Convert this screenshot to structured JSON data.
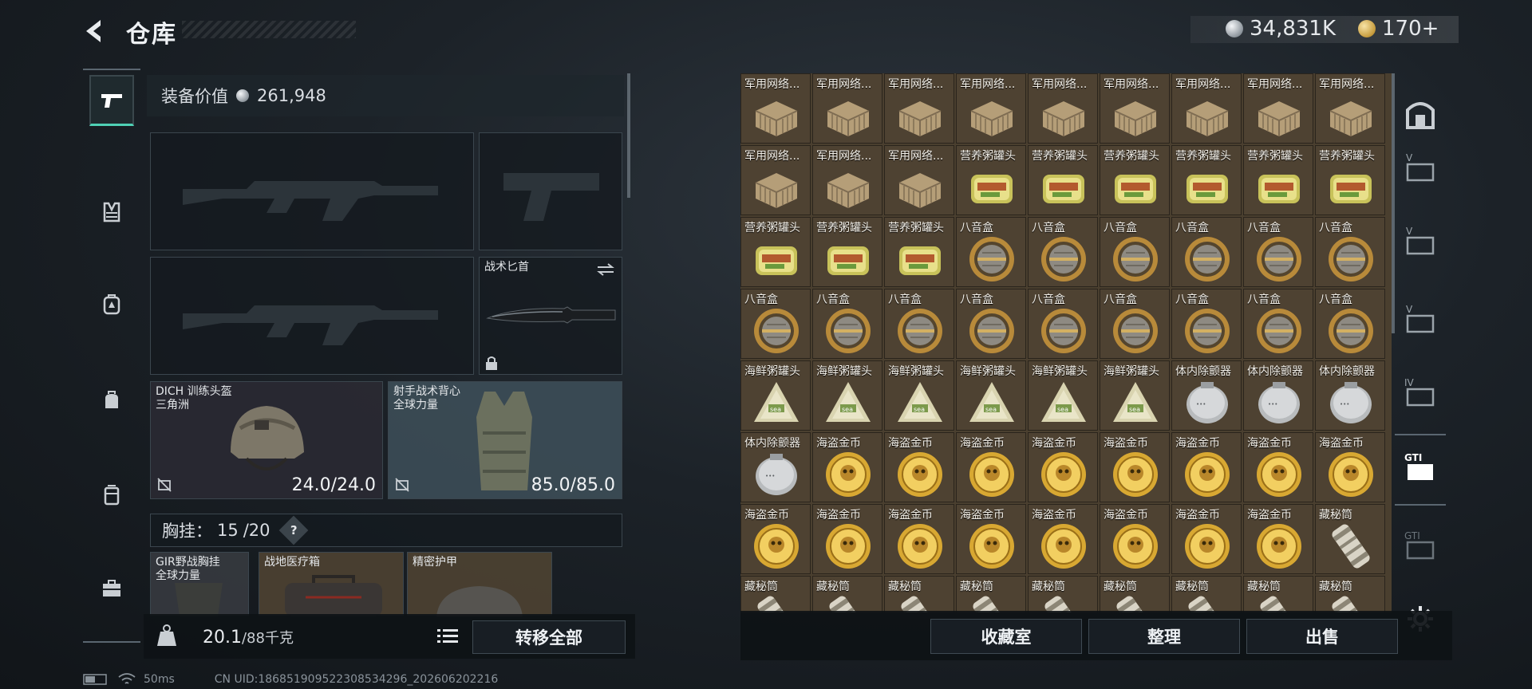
{
  "header": {
    "title": "仓库",
    "silver": "34,831K",
    "gold": "170+"
  },
  "equipment": {
    "value_label": "装备价值",
    "value": "261,948",
    "knife_label": "战术匕首",
    "helmet": {
      "label": "DICH 训练头盔\n三角洲",
      "durability": "24.0/24.0"
    },
    "vest": {
      "label": "射手战术背心\n全球力量",
      "durability": "85.0/85.0"
    },
    "chest_label": "胸挂：",
    "chest_used": "15",
    "chest_total": "/20",
    "help": "?",
    "sub_items": [
      {
        "label": "GIR野战胸挂\n全球力量"
      },
      {
        "label": "战地医疗箱"
      },
      {
        "label": "精密护甲"
      }
    ],
    "weight": "20.1",
    "weight_max": "/88千克",
    "transfer_all": "转移全部"
  },
  "status": {
    "ping": "50ms",
    "uid": "CN UID:18685190952230853429​6_202606202216"
  },
  "grid": {
    "rows": [
      [
        "军用网络...",
        "军用网络...",
        "军用网络...",
        "军用网络...",
        "军用网络...",
        "军用网络...",
        "军用网络...",
        "军用网络...",
        "军用网络..."
      ],
      [
        "军用网络...",
        "军用网络...",
        "军用网络...",
        "营养粥罐头",
        "营养粥罐头",
        "营养粥罐头",
        "营养粥罐头",
        "营养粥罐头",
        "营养粥罐头"
      ],
      [
        "营养粥罐头",
        "营养粥罐头",
        "营养粥罐头",
        "八音盒",
        "八音盒",
        "八音盒",
        "八音盒",
        "八音盒",
        "八音盒"
      ],
      [
        "八音盒",
        "八音盒",
        "八音盒",
        "八音盒",
        "八音盒",
        "八音盒",
        "八音盒",
        "八音盒",
        "八音盒"
      ],
      [
        "海鲜粥罐头",
        "海鲜粥罐头",
        "海鲜粥罐头",
        "海鲜粥罐头",
        "海鲜粥罐头",
        "海鲜粥罐头",
        "体内除颤器",
        "体内除颤器",
        "体内除颤器"
      ],
      [
        "体内除颤器",
        "海盗金币",
        "海盗金币",
        "海盗金币",
        "海盗金币",
        "海盗金币",
        "海盗金币",
        "海盗金币",
        "海盗金币"
      ],
      [
        "海盗金币",
        "海盗金币",
        "海盗金币",
        "海盗金币",
        "海盗金币",
        "海盗金币",
        "海盗金币",
        "海盗金币",
        "藏秘筒"
      ],
      [
        "藏秘筒",
        "藏秘筒",
        "藏秘筒",
        "藏秘筒",
        "藏秘筒",
        "藏秘筒",
        "藏秘筒",
        "藏秘筒",
        "藏秘筒"
      ]
    ]
  },
  "actions": {
    "collection": "收藏室",
    "organize": "整理",
    "sell": "出售"
  }
}
